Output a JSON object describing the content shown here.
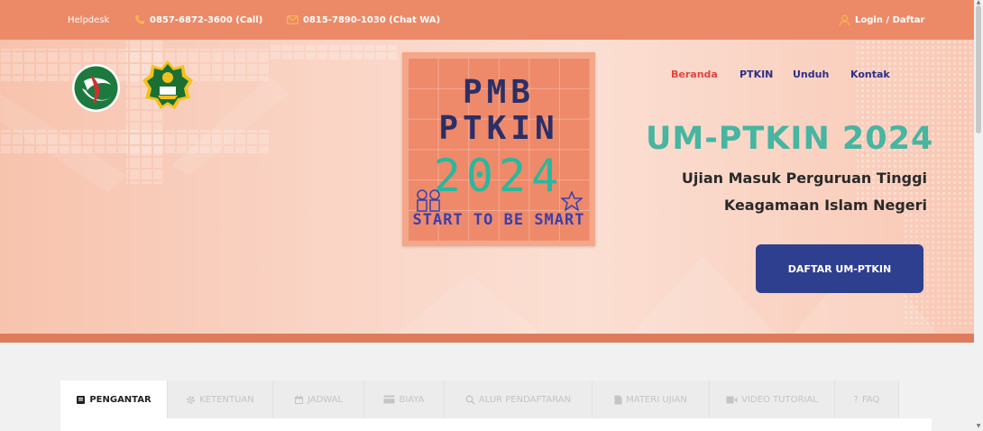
{
  "topbar": {
    "helpdesk": "Helpdesk",
    "phone": "0857-6872-3600 (Call)",
    "whatsapp": "0815-7890-1030 (Chat WA)",
    "login": "Login / Daftar",
    "icons": [
      "phone-icon",
      "mail-icon",
      "user-icon"
    ]
  },
  "nav": {
    "items": [
      "Beranda",
      "PTKIN",
      "Unduh",
      "Kontak"
    ],
    "active": "Beranda"
  },
  "poster": {
    "line1": "PMB",
    "line2": "PTKIN",
    "year": "2024",
    "tagline": "START TO BE SMART"
  },
  "hero": {
    "title": "UM-PTKIN 2024",
    "subtitle_line1": "Ujian Masuk Perguruan Tinggi",
    "subtitle_line2": "Keagamaan Islam Negeri",
    "cta": "DAFTAR UM-PTKIN"
  },
  "tabs": {
    "items": [
      {
        "label": "PENGANTAR",
        "icon": "book-icon"
      },
      {
        "label": "KETENTUAN",
        "icon": "gear-icon"
      },
      {
        "label": "JADWAL",
        "icon": "calendar-icon"
      },
      {
        "label": "BIAYA",
        "icon": "card-icon"
      },
      {
        "label": "ALUR PENDAFTARAN",
        "icon": "search-icon"
      },
      {
        "label": "MATERI UJIAN",
        "icon": "file-icon"
      },
      {
        "label": "VIDEO TUTORIAL",
        "icon": "video-icon"
      },
      {
        "label": "FAQ",
        "icon": "question-icon"
      }
    ],
    "active": "PENGANTAR"
  },
  "colors": {
    "topbar": "#ec8a68",
    "nav_active": "#e5433e",
    "nav": "#2b2f8a",
    "title_teal": "#46b5a1",
    "cta": "#2f3f8f"
  }
}
